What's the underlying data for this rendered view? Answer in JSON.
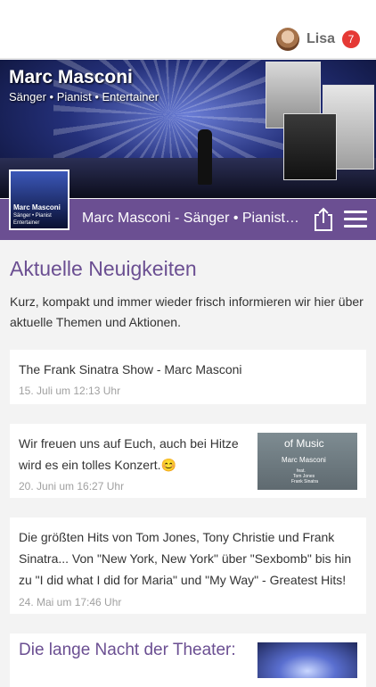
{
  "user": {
    "name": "Lisa",
    "notifications": "7"
  },
  "hero": {
    "title": "Marc Masconi",
    "subtitle": "Sänger • Pianist • Entertainer",
    "logo_title": "Marc Masconi",
    "logo_line1": "Sänger • Pianist",
    "logo_line2": "Entertainer"
  },
  "titlebar": {
    "text": "Marc Masconi - Sänger • Pianist • Entertainer"
  },
  "page": {
    "heading": "Aktuelle Neuigkeiten",
    "intro": "Kurz, kompakt und immer wieder frisch informieren wir hier über aktuelle Themen und Aktionen."
  },
  "posts": [
    {
      "text": "The Frank Sinatra Show - Marc Masconi",
      "date": "15. Juli um 12:13 Uhr"
    },
    {
      "text": "Wir freuen uns auf Euch, auch bei Hitze wird es ein tolles Konzert.😊",
      "date": "20. Juni um 16:27 Uhr",
      "image": {
        "line1": "of Music",
        "line2": "Marc Masconi",
        "line3": "feat.",
        "line4": "Tom Jones",
        "line5": "Frank Sinatra"
      }
    },
    {
      "text": "Die größten Hits von Tom Jones, Tony Christie und Frank Sinatra... Von \"New York, New York\" über \"Sexbomb\" bis hin zu \"I did what I did for Maria\" und \"My Way\" - Greatest Hits!",
      "date": "24. Mai um 17:46 Uhr"
    },
    {
      "title": "Die lange Nacht der Theater:"
    }
  ],
  "colors": {
    "accent": "#6b4f92",
    "badge": "#e53935"
  }
}
